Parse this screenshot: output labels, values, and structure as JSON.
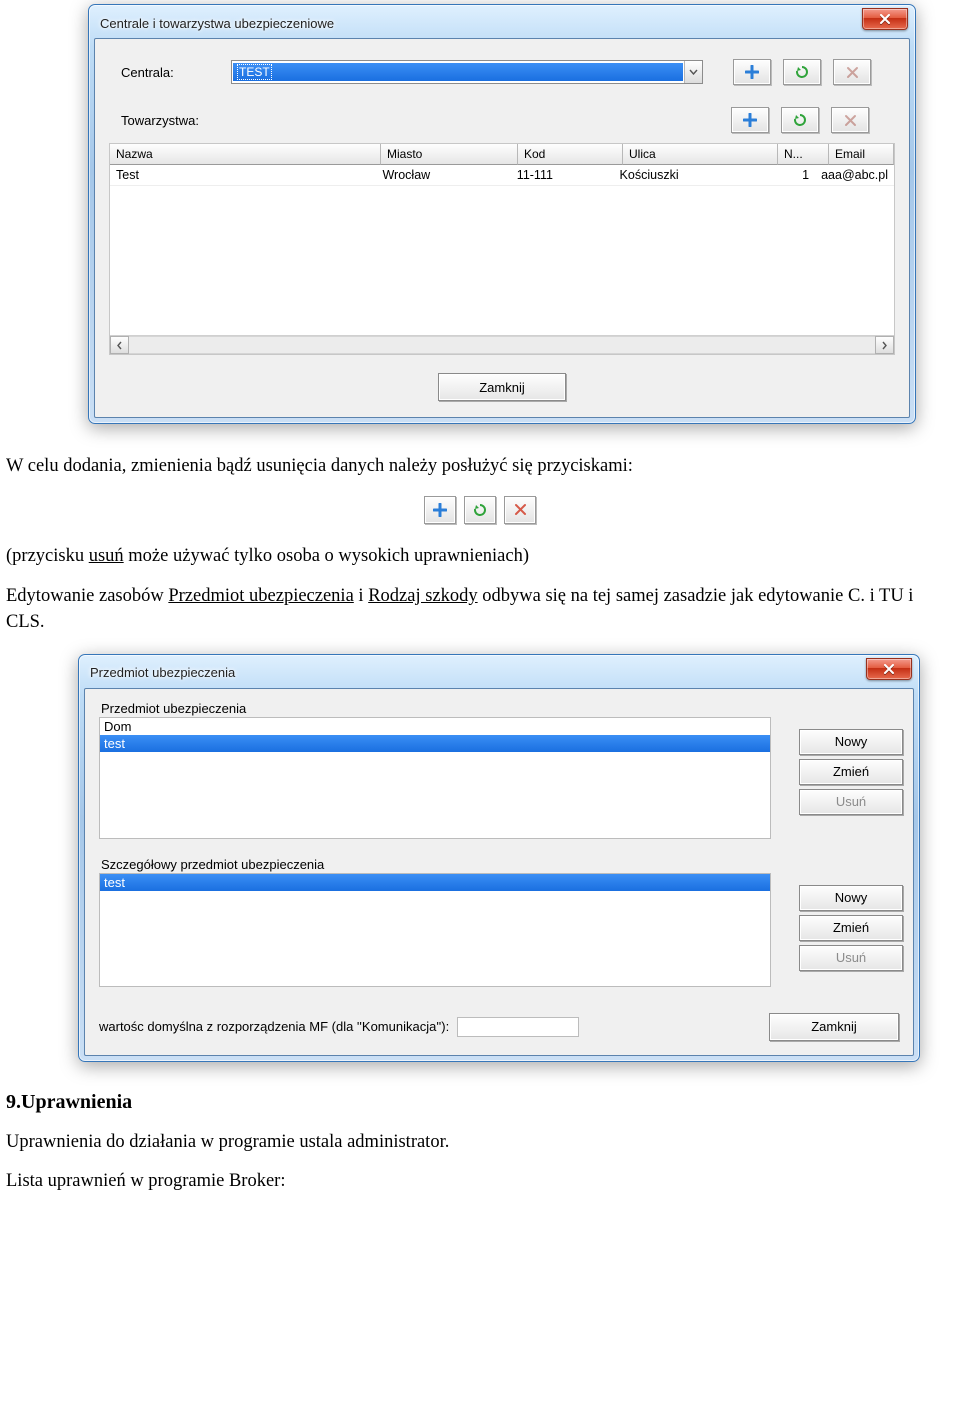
{
  "window1": {
    "title": "Centrale i towarzystwa ubezpieczeniowe",
    "field_centrala_label": "Centrala:",
    "centrala_value": "TEST",
    "field_towarzystwa_label": "Towarzystwa:",
    "columns": [
      "Nazwa",
      "Miasto",
      "Kod",
      "Ulica",
      "N...",
      "Email"
    ],
    "rows": [
      {
        "nazwa": "Test",
        "miasto": "Wrocław",
        "kod": "11-111",
        "ulica": "Kościuszki",
        "n": "1",
        "email": "aaa@abc.pl"
      }
    ],
    "close_label": "Zamknij"
  },
  "paragraph1_a": "W celu dodania, zmienienia bądź usunięcia  danych należy posłużyć się przyciskami:",
  "paragraph2_prefix": "(przycisku ",
  "paragraph2_u": "usuń",
  "paragraph2_suffix": " może używać tylko osoba o wysokich uprawnieniach)",
  "paragraph3_a": "Edytowanie zasobów ",
  "paragraph3_u1": "Przedmiot ubezpieczenia",
  "paragraph3_mid": " i ",
  "paragraph3_u2": "Rodzaj szkody",
  "paragraph3_b": " odbywa się na tej samej zasadzie jak edytowanie C. i TU i CLS.",
  "window2": {
    "title": "Przedmiot ubezpieczenia",
    "section1_label": "Przedmiot ubezpieczenia",
    "list1": [
      "Dom",
      "test"
    ],
    "section2_label": "Szczegółowy przedmiot ubezpieczenia",
    "list2": [
      "test"
    ],
    "btn_new": "Nowy",
    "btn_edit": "Zmień",
    "btn_del": "Usuń",
    "default_label": "wartośc domyślna z rozporządzenia MF (dla ''Komunikacja''):",
    "close_label": "Zamknij"
  },
  "heading9": "9.Uprawnienia",
  "paragraph4": "Uprawnienia do działania w programie ustala administrator.",
  "paragraph5": "Lista uprawnień w programie Broker:"
}
